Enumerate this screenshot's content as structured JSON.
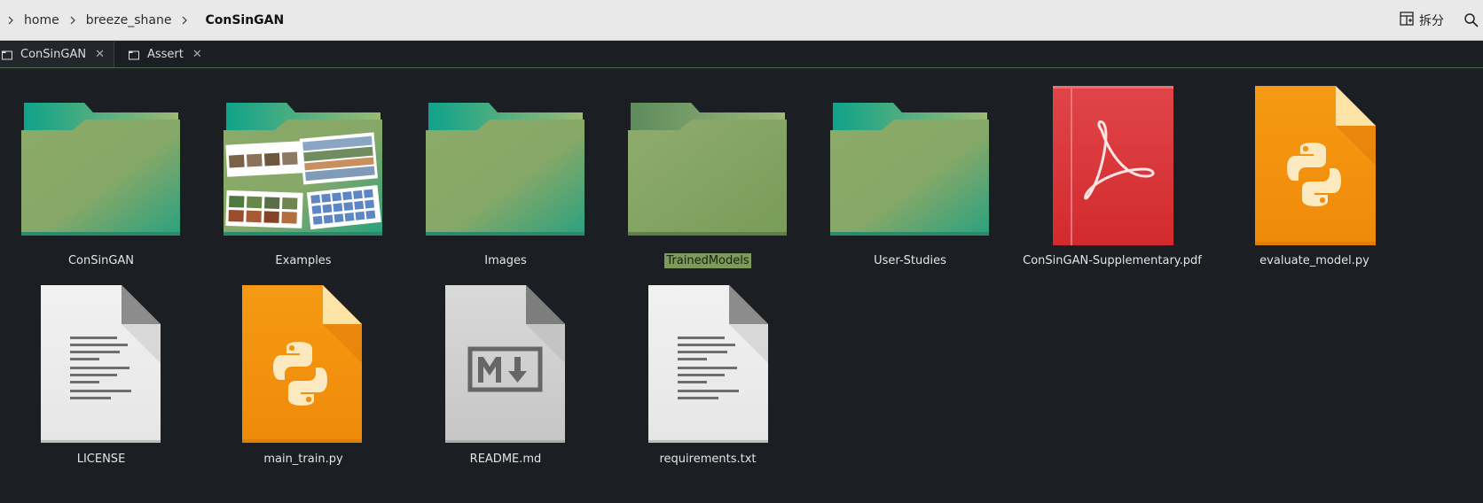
{
  "breadcrumb": {
    "items": [
      "home",
      "breeze_shane",
      "ConSinGAN"
    ]
  },
  "toolbar": {
    "split_label": "拆分"
  },
  "tabs": [
    {
      "label": "ConSinGAN",
      "active": true
    },
    {
      "label": "Assert",
      "active": false
    }
  ],
  "files": [
    {
      "name": "ConSinGAN",
      "type": "folder",
      "icon": "folder-icon",
      "selected": false
    },
    {
      "name": "Examples",
      "type": "folder",
      "icon": "folder-with-preview-icon",
      "selected": false
    },
    {
      "name": "Images",
      "type": "folder",
      "icon": "folder-icon",
      "selected": false
    },
    {
      "name": "TrainedModels",
      "type": "folder",
      "icon": "folder-icon",
      "selected": true
    },
    {
      "name": "User-Studies",
      "type": "folder",
      "icon": "folder-icon",
      "selected": false
    },
    {
      "name": "ConSinGAN-Supplementary.pdf",
      "type": "pdf",
      "icon": "pdf-icon",
      "selected": false
    },
    {
      "name": "evaluate_model.py",
      "type": "python",
      "icon": "python-file-icon",
      "selected": false
    },
    {
      "name": "LICENSE",
      "type": "text",
      "icon": "text-file-icon",
      "selected": false
    },
    {
      "name": "main_train.py",
      "type": "python",
      "icon": "python-file-icon",
      "selected": false
    },
    {
      "name": "README.md",
      "type": "markdown",
      "icon": "markdown-file-icon",
      "selected": false
    },
    {
      "name": "requirements.txt",
      "type": "text",
      "icon": "text-file-icon",
      "selected": false
    }
  ],
  "colors": {
    "background": "#1b1e22",
    "folder_front": "#8aaa68",
    "folder_tab": "#16a085",
    "selection": "#7d9a5a",
    "python_orange": "#f5980f",
    "pdf_red": "#dc3a3d"
  }
}
